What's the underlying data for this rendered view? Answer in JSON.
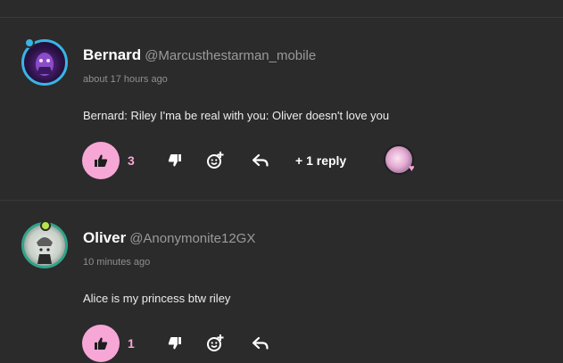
{
  "comments": [
    {
      "name": "Bernard",
      "handle": "@Marcusthestarman_mobile",
      "time": "about 17 hours ago",
      "text": "Bernard: Riley I'ma be real with you:  Oliver doesn't love you",
      "likes": "3",
      "replies_label": "+ 1 reply"
    },
    {
      "name": "Oliver",
      "handle": "@Anonymonite12GX",
      "time": "10 minutes ago",
      "text": "Alice is my princess btw riley",
      "likes": "1"
    }
  ],
  "colors": {
    "background": "#2b2b2b",
    "accent_pink": "#f7a7d6",
    "avatar_ring_blue": "#3ab4e6",
    "avatar_ring_green": "#2fa58a"
  },
  "icons": {
    "like": "thumbs-up-icon",
    "dislike": "thumbs-down-icon",
    "react": "add-emoji-icon",
    "reply": "reply-arrow-icon",
    "heart": "heart-icon"
  }
}
